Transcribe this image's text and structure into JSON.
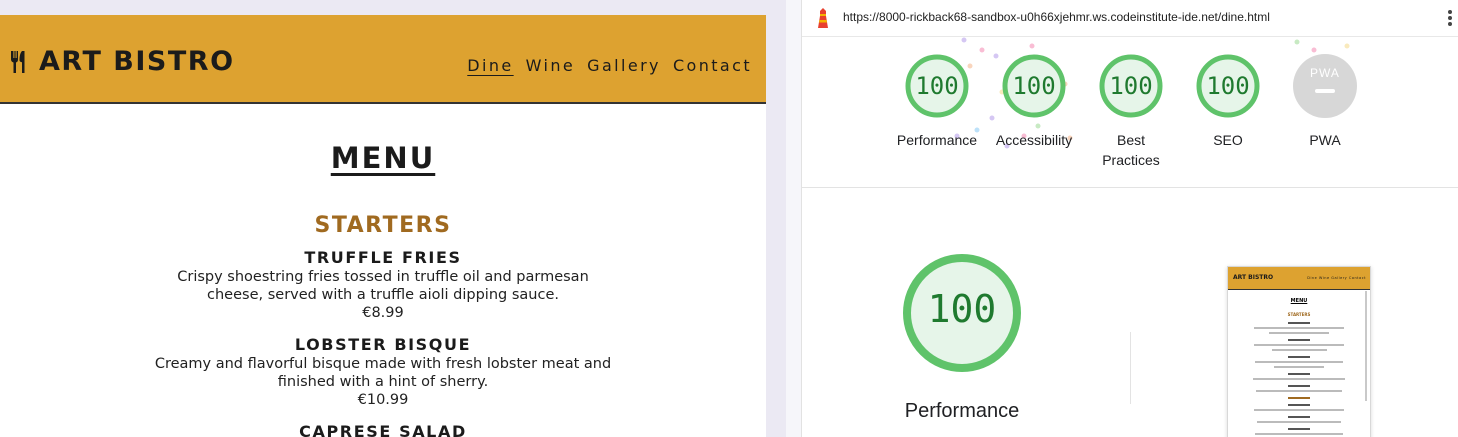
{
  "site": {
    "brand": "ART BISTRO",
    "nav": [
      {
        "label": "Dine",
        "active": true
      },
      {
        "label": "Wine",
        "active": false
      },
      {
        "label": "Gallery",
        "active": false
      },
      {
        "label": "Contact",
        "active": false
      }
    ],
    "menu_title": "MENU",
    "section_title": "STARTERS",
    "dishes": [
      {
        "name": "TRUFFLE FRIES",
        "description": "Crispy shoestring fries tossed in truffle oil and parmesan cheese, served with a truffle aioli dipping sauce.",
        "price": "€8.99"
      },
      {
        "name": "LOBSTER BISQUE",
        "description": "Creamy and flavorful bisque made with fresh lobster meat and finished with a hint of sherry.",
        "price": "€10.99"
      },
      {
        "name": "CAPRESE SALAD",
        "description": "",
        "price": ""
      }
    ],
    "colors": {
      "header": "#dda230",
      "section": "#a06a20"
    }
  },
  "lighthouse": {
    "url": "https://8000-rickback68-sandbox-u0h66xjehmr.ws.codeinstitute-ide.net/dine.html",
    "categories": [
      {
        "label": "Performance",
        "score": "100"
      },
      {
        "label": "Accessibility",
        "score": "100"
      },
      {
        "label": "Best Practices",
        "score": "100"
      },
      {
        "label": "SEO",
        "score": "100"
      },
      {
        "label": "PWA",
        "score": ""
      }
    ],
    "pwa_badge": "PWA",
    "main_score": "100",
    "main_label": "Performance",
    "colors": {
      "pass": "#0cce6b",
      "pass_text": "#1f7a2f",
      "ring_bg": "#e6f5e9"
    }
  }
}
